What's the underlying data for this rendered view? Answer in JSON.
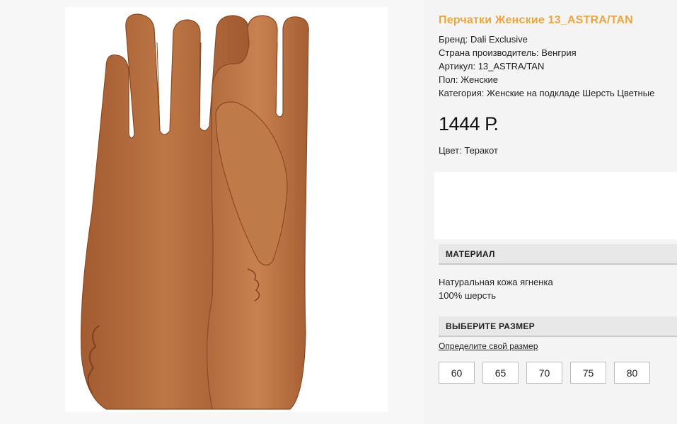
{
  "product": {
    "title": "Перчатки Женские 13_ASTRA/TAN",
    "image_alt": "glove-product-image",
    "specs": [
      "Бренд: Dali Exclusive",
      "Страна производитель: Венгрия",
      "Артикул: 13_ASTRA/TAN",
      "Пол: Женские",
      "Категория: Женские на подкладе Шерсть Цветные"
    ],
    "price": "1444 Р.",
    "color": "Цвет: Теракот"
  },
  "material": {
    "header": "МАТЕРИАЛ",
    "lines": [
      "Натуральная кожа ягненка",
      "100% шерсть"
    ]
  },
  "size": {
    "header": "ВЫБЕРИТЕ РАЗМЕР",
    "link": "Определите свой размер",
    "options": [
      "60",
      "65",
      "70",
      "75",
      "80"
    ]
  },
  "colors": {
    "title": "#e9a641",
    "leather": "#b36a3c",
    "leather_dark": "#8f4f29",
    "leather_light": "#c98553"
  }
}
